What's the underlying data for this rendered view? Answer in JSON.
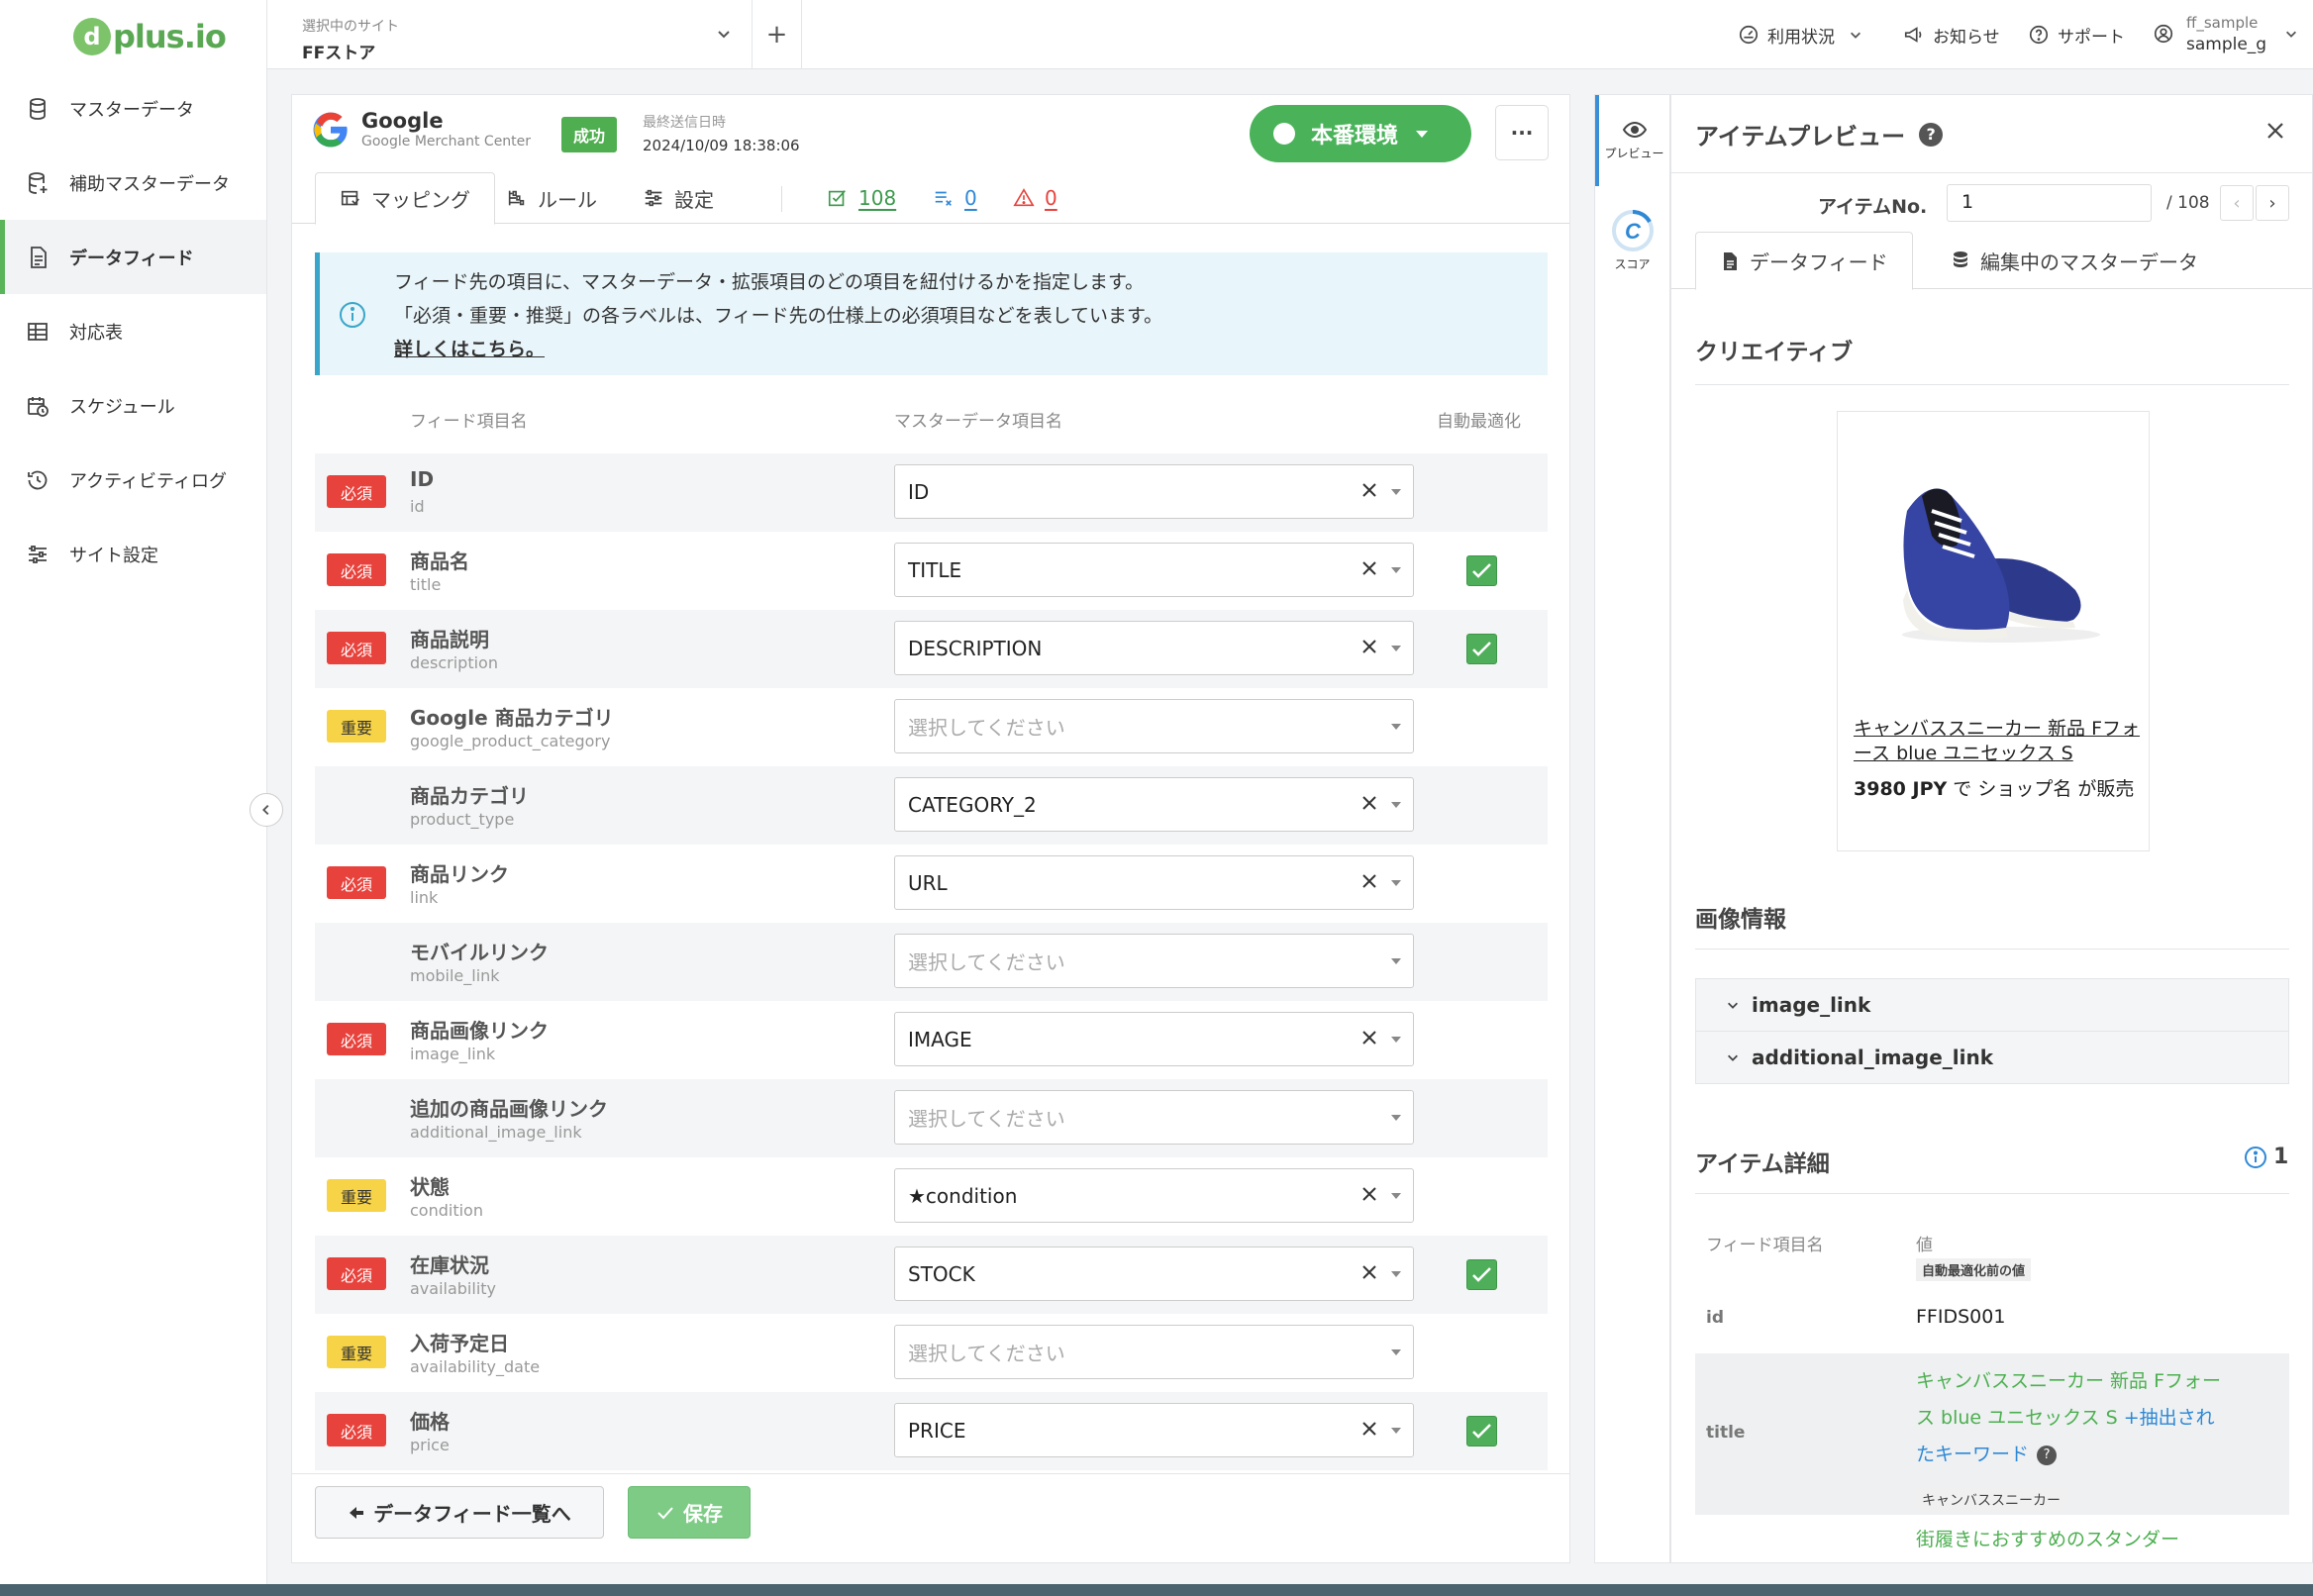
{
  "brand": {
    "logo_circle": "d",
    "logo_text": "plus.io"
  },
  "sidebar": {
    "items": [
      {
        "label": "マスターデータ",
        "icon": "database-icon",
        "active": false
      },
      {
        "label": "補助マスターデータ",
        "icon": "database-plus-icon",
        "active": false
      },
      {
        "label": "データフィード",
        "icon": "document-icon",
        "active": true
      },
      {
        "label": "対応表",
        "icon": "table-icon",
        "active": false
      },
      {
        "label": "スケジュール",
        "icon": "calendar-clock-icon",
        "active": false
      },
      {
        "label": "アクティビティログ",
        "icon": "history-icon",
        "active": false
      },
      {
        "label": "サイト設定",
        "icon": "sliders-icon",
        "active": false
      }
    ]
  },
  "topbar": {
    "site_label": "選択中のサイト",
    "site_value": "FFストア",
    "add_label": "+",
    "usage": "利用状況",
    "notice": "お知らせ",
    "support": "サポート",
    "user_name": "ff_sample",
    "user_id": "sample_g"
  },
  "feed": {
    "title": "Google",
    "subtitle": "Google Merchant Center",
    "status": "成功",
    "last_sent_label": "最終送信日時",
    "last_sent_value": "2024/10/09 18:38:06",
    "env_label": "本番環境",
    "more_label": "···"
  },
  "tabs": {
    "mapping": "マッピング",
    "rules": "ルール",
    "settings": "設定",
    "count_items": "108",
    "count_excluded": "0",
    "count_warnings": "0"
  },
  "info": {
    "line1": "フィード先の項目に、マスターデータ・拡張項目のどの項目を紐付けるかを指定します。",
    "line2": "「必須・重要・推奨」の各ラベルは、フィード先の仕様上の必須項目などを表しています。",
    "link": "詳しくはこちら。"
  },
  "columns": {
    "feed_item": "フィード項目名",
    "master_item": "マスターデータ項目名",
    "auto_opt": "自動最適化"
  },
  "badges": {
    "must": "必須",
    "imp": "重要"
  },
  "rows": [
    {
      "badge": "must",
      "name": "ID",
      "key": "id",
      "value": "ID",
      "placeholder": false,
      "clear": true,
      "auto": false
    },
    {
      "badge": "must",
      "name": "商品名",
      "key": "title",
      "value": "TITLE",
      "placeholder": false,
      "clear": true,
      "auto": true
    },
    {
      "badge": "must",
      "name": "商品説明",
      "key": "description",
      "value": "DESCRIPTION",
      "placeholder": false,
      "clear": true,
      "auto": true
    },
    {
      "badge": "imp",
      "name": "Google 商品カテゴリ",
      "key": "google_product_category",
      "value": "選択してください",
      "placeholder": true,
      "clear": false,
      "auto": false
    },
    {
      "badge": "",
      "name": "商品カテゴリ",
      "key": "product_type",
      "value": "CATEGORY_2",
      "placeholder": false,
      "clear": true,
      "auto": false
    },
    {
      "badge": "must",
      "name": "商品リンク",
      "key": "link",
      "value": "URL",
      "placeholder": false,
      "clear": true,
      "auto": false
    },
    {
      "badge": "",
      "name": "モバイルリンク",
      "key": "mobile_link",
      "value": "選択してください",
      "placeholder": true,
      "clear": false,
      "auto": false
    },
    {
      "badge": "must",
      "name": "商品画像リンク",
      "key": "image_link",
      "value": "IMAGE",
      "placeholder": false,
      "clear": true,
      "auto": false
    },
    {
      "badge": "",
      "name": "追加の商品画像リンク",
      "key": "additional_image_link",
      "value": "選択してください",
      "placeholder": true,
      "clear": false,
      "auto": false
    },
    {
      "badge": "imp",
      "name": "状態",
      "key": "condition",
      "value": "★condition",
      "placeholder": false,
      "clear": true,
      "auto": false
    },
    {
      "badge": "must",
      "name": "在庫状況",
      "key": "availability",
      "value": "STOCK",
      "placeholder": false,
      "clear": true,
      "auto": true
    },
    {
      "badge": "imp",
      "name": "入荷予定日",
      "key": "availability_date",
      "value": "選択してください",
      "placeholder": true,
      "clear": false,
      "auto": false
    },
    {
      "badge": "must",
      "name": "価格",
      "key": "price",
      "value": "PRICE",
      "placeholder": false,
      "clear": true,
      "auto": true
    }
  ],
  "footer": {
    "back": "データフィード一覧へ",
    "save": "保存"
  },
  "side_tools": {
    "preview": "プレビュー",
    "score": "スコア"
  },
  "preview": {
    "title": "アイテムプレビュー",
    "help": "?",
    "item_no_label": "アイテムNo.",
    "item_no_value": "1",
    "item_total": "/ 108",
    "tab_feed": "データフィード",
    "tab_master": "編集中のマスターデータ",
    "creative_title": "クリエイティブ",
    "creative_product": "キャンバススニーカー 新品 Fフォース blue ユニセックス S",
    "creative_price": "3980 JPY",
    "creative_seller": " で ショップ名 が販売",
    "image_info_title": "画像情報",
    "image_link": "image_link",
    "additional_image_link": "additional_image_link",
    "detail_title": "アイテム詳細",
    "detail_count": "1",
    "detail_col_name": "フィード項目名",
    "detail_col_value": "値",
    "detail_tag": "自動最適化前の値",
    "id_key": "id",
    "id_value": "FFIDS001",
    "title_key": "title",
    "title_value_main": "キャンバススニーカー 新品 Fフォース blue ユニセックス S",
    "title_value_added": "+抽出されたキーワード",
    "title_help": "?",
    "title_original": "キャンバススニーカー",
    "desc_value": "街履きにおすすめのスタンダー"
  }
}
